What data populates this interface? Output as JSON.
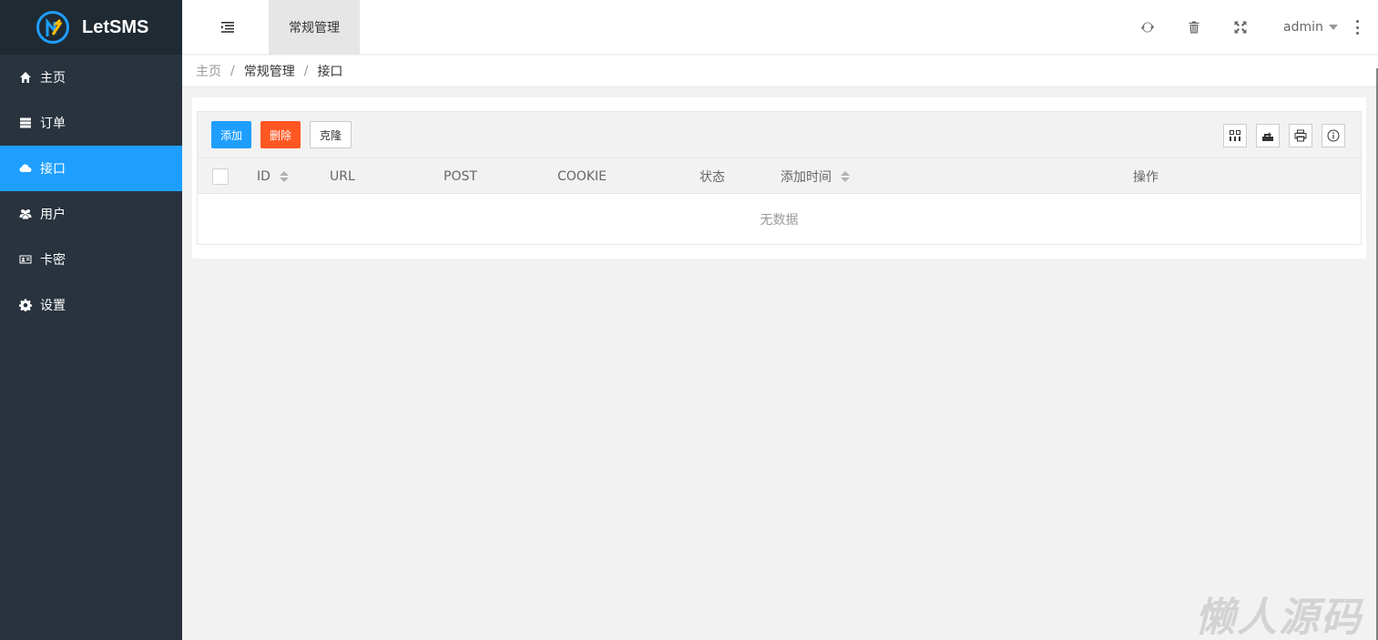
{
  "app": {
    "name": "LetSMS"
  },
  "sidebar": {
    "items": [
      {
        "label": "主页",
        "icon": "home-icon",
        "active": false
      },
      {
        "label": "订单",
        "icon": "server-icon",
        "active": false
      },
      {
        "label": "接口",
        "icon": "cloud-icon",
        "active": true
      },
      {
        "label": "用户",
        "icon": "users-icon",
        "active": false
      },
      {
        "label": "卡密",
        "icon": "id-card-icon",
        "active": false
      },
      {
        "label": "设置",
        "icon": "gear-icon",
        "active": false
      }
    ]
  },
  "header": {
    "tab_label": "常规管理",
    "user": "admin",
    "icons": [
      "menu-toggle-icon",
      "refresh-icon",
      "trash-icon",
      "fullscreen-icon",
      "more-icon"
    ]
  },
  "breadcrumb": [
    "主页",
    "常规管理",
    "接口"
  ],
  "toolbar": {
    "add_label": "添加",
    "delete_label": "删除",
    "clone_label": "克隆",
    "right_icons": [
      "columns-icon",
      "export-icon",
      "print-icon",
      "info-icon"
    ]
  },
  "table": {
    "columns": [
      "ID",
      "URL",
      "POST",
      "COOKIE",
      "状态",
      "添加时间",
      "操作"
    ],
    "empty_text": "无数据"
  },
  "watermark": "懒人源码",
  "colors": {
    "sidebar_bg": "#28333e",
    "logo_bg": "#1f2a33",
    "primary": "#1e9fff",
    "danger": "#ff5722"
  }
}
